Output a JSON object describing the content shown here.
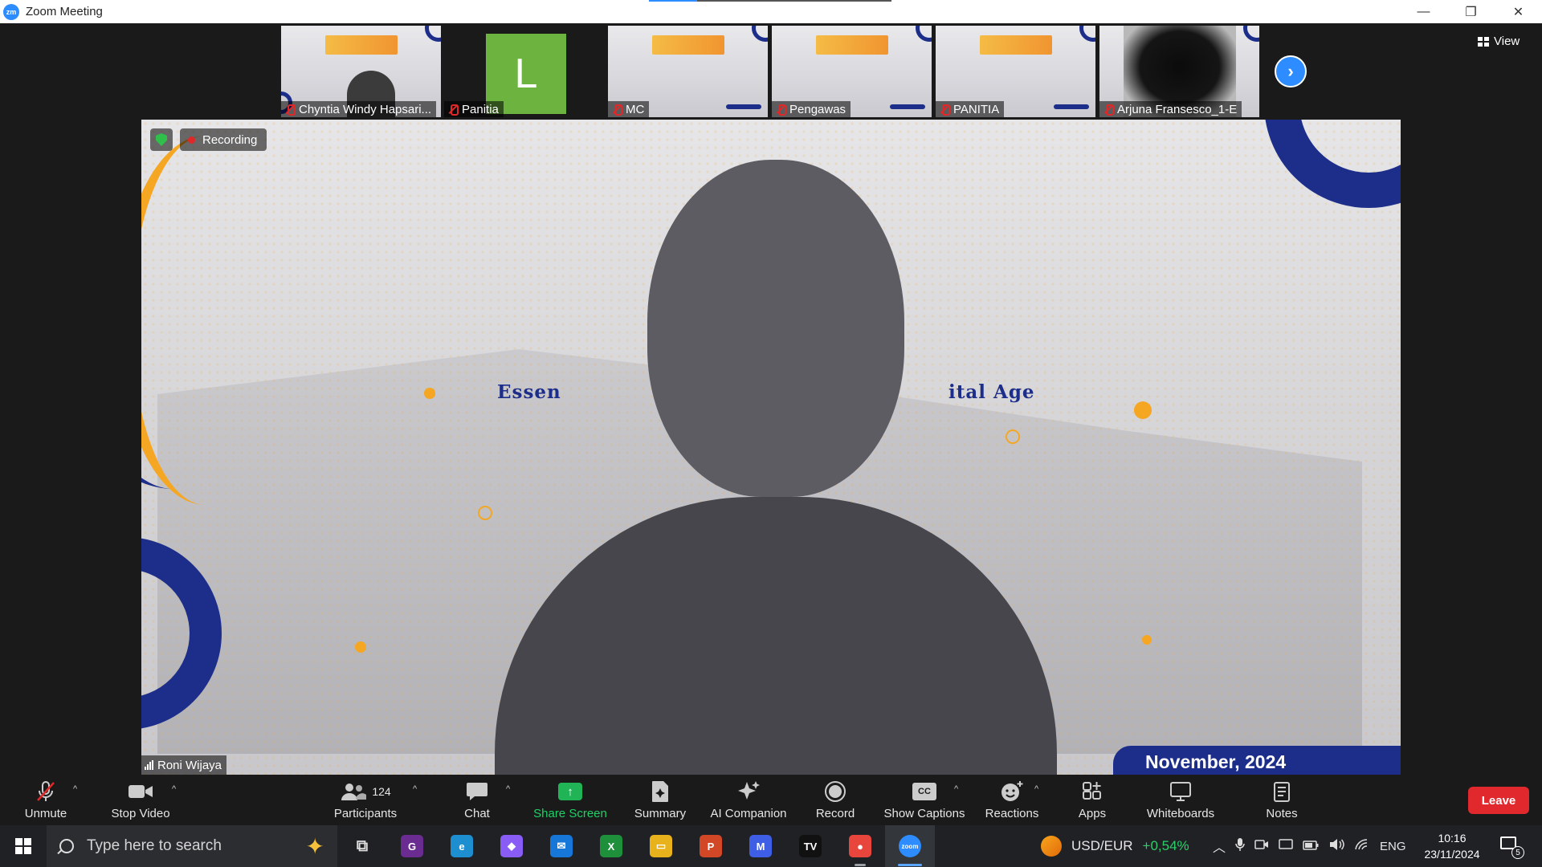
{
  "window": {
    "title": "Zoom Meeting",
    "logo_text": "zm",
    "minimize": "—",
    "restore": "❐",
    "close": "✕"
  },
  "view_button": {
    "label": "View"
  },
  "thumbnails": [
    {
      "name": "Chyntia Windy Hapsari...",
      "kind": "slide-person",
      "muted": true
    },
    {
      "name": "Panitia",
      "kind": "avatar",
      "avatar_letter": "L",
      "avatar_color": "#6db33f",
      "muted": true
    },
    {
      "name": "MC",
      "kind": "slide",
      "muted": true
    },
    {
      "name": "Pengawas",
      "kind": "slide",
      "muted": true
    },
    {
      "name": "PANITIA",
      "kind": "slide",
      "muted": true
    },
    {
      "name": "Arjuna Fransesco_1-E",
      "kind": "obscured",
      "muted": true
    }
  ],
  "next_arrow": "›",
  "main_video": {
    "recording_label": "Recording",
    "speaker_name": "Roni Wijaya",
    "slide_fragment_left": "Essen",
    "slide_fragment_right": "ital Age",
    "slide_date_fragment": "November, 2024"
  },
  "toolbar": {
    "unmute": "Unmute",
    "stop_video": "Stop Video",
    "participants": "Participants",
    "participants_count": "124",
    "chat": "Chat",
    "share_screen": "Share Screen",
    "summary": "Summary",
    "ai_companion": "AI Companion",
    "record": "Record",
    "show_captions": "Show Captions",
    "captions_icon_text": "CC",
    "reactions": "Reactions",
    "apps": "Apps",
    "whiteboards": "Whiteboards",
    "notes": "Notes",
    "leave": "Leave",
    "caret": "^",
    "share_arrow": "↑"
  },
  "taskbar": {
    "search_placeholder": "Type here to search",
    "ticker_pair": "USD/EUR",
    "ticker_change": "+0,54%",
    "tray_lang": "ENG",
    "time": "10:16",
    "date": "23/11/2024",
    "notification_count": "5",
    "apps": [
      {
        "name": "task-view-icon",
        "glyph": "⧉",
        "color": "transparent"
      },
      {
        "name": "pdf-app-icon",
        "glyph": "G",
        "color": "#6a2c91"
      },
      {
        "name": "edge-browser-icon",
        "glyph": "e",
        "color": "#1d8fd1"
      },
      {
        "name": "copilot-icon",
        "glyph": "◆",
        "color": "#8a5cf6"
      },
      {
        "name": "mail-icon",
        "glyph": "✉",
        "color": "#1677d8"
      },
      {
        "name": "xbox-icon",
        "glyph": "X",
        "color": "#1e8f3a"
      },
      {
        "name": "file-explorer-icon",
        "glyph": "▭",
        "color": "#e8b21d"
      },
      {
        "name": "powerpoint-icon",
        "glyph": "P",
        "color": "#d24726"
      },
      {
        "name": "math-app-icon",
        "glyph": "M",
        "color": "#3f5ee6"
      },
      {
        "name": "tradingview-icon",
        "glyph": "TV",
        "color": "#111111"
      },
      {
        "name": "chrome-icon",
        "glyph": "●",
        "color": "#e8453c"
      },
      {
        "name": "zoom-icon",
        "glyph": "zoom",
        "color": "#2d8cff"
      }
    ]
  }
}
